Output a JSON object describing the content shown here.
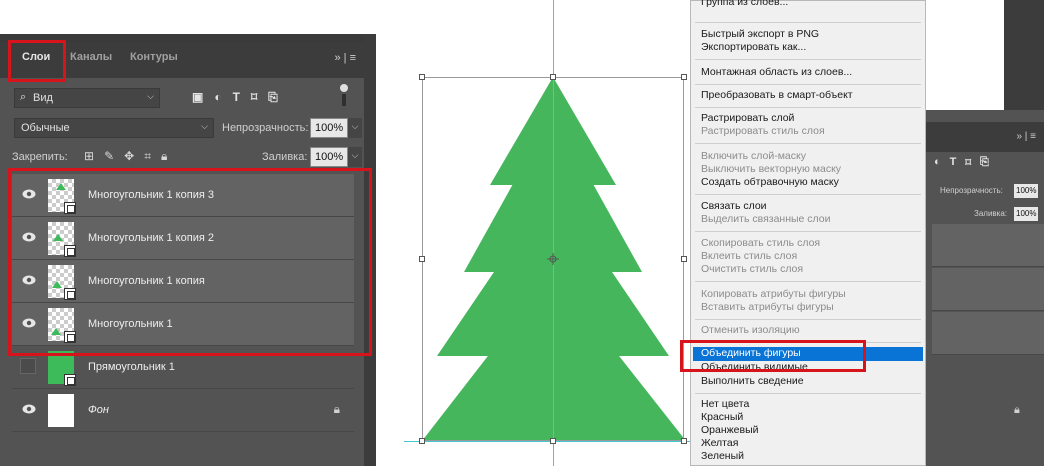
{
  "layers_panel": {
    "tabs": [
      "Слои",
      "Каналы",
      "Контуры"
    ],
    "menu_glyph": "»  |  ≡",
    "filter": {
      "search_glyph": "⌕",
      "label": "Вид"
    },
    "blend_mode": "Обычные",
    "opacity_label": "Непрозрачность:",
    "opacity_value": "100%",
    "lock_label": "Закрепить:",
    "fill_label": "Заливка:",
    "fill_value": "100%",
    "layers": [
      {
        "name": "Многоугольник 1 копия 3",
        "visible": true,
        "kind": "polygon"
      },
      {
        "name": "Многоугольник 1 копия 2",
        "visible": true,
        "kind": "polygon"
      },
      {
        "name": "Многоугольник 1 копия",
        "visible": true,
        "kind": "polygon"
      },
      {
        "name": "Многоугольник 1",
        "visible": true,
        "kind": "polygon"
      },
      {
        "name": "Прямоугольник 1",
        "visible": false,
        "kind": "rectangle"
      },
      {
        "name": "Фон",
        "visible": true,
        "kind": "background",
        "locked": true
      }
    ],
    "icons": {
      "filter_icons": [
        "image-filter-icon",
        "adjustment-filter-icon",
        "type-filter-icon",
        "shape-filter-icon",
        "smart-object-filter-icon"
      ],
      "lock_icons": [
        "lock-transparent-icon",
        "lock-image-icon",
        "lock-position-icon",
        "lock-artboard-icon",
        "lock-all-icon"
      ]
    }
  },
  "context_menu": {
    "items": [
      {
        "label": "Группа из слоев...",
        "disabled": false
      },
      {
        "label": "Быстрый экспорт в PNG",
        "disabled": false
      },
      {
        "label": "Экспортировать как...",
        "disabled": false
      },
      {
        "label": "Монтажная область из слоев...",
        "disabled": false
      },
      {
        "label": "Преобразовать в смарт-объект",
        "disabled": false
      },
      {
        "label": "Растрировать слой",
        "disabled": false
      },
      {
        "label": "Растрировать стиль слоя",
        "disabled": true
      },
      {
        "label": "Включить слой-маску",
        "disabled": true
      },
      {
        "label": "Выключить векторную маску",
        "disabled": true
      },
      {
        "label": "Создать обтравочную маску",
        "disabled": false
      },
      {
        "label": "Связать слои",
        "disabled": false
      },
      {
        "label": "Выделить связанные слои",
        "disabled": true
      },
      {
        "label": "Скопировать стиль слоя",
        "disabled": true
      },
      {
        "label": "Вклеить стиль слоя",
        "disabled": true
      },
      {
        "label": "Очистить стиль слоя",
        "disabled": true
      },
      {
        "label": "Копировать атрибуты фигуры",
        "disabled": true
      },
      {
        "label": "Вставить атрибуты фигуры",
        "disabled": true
      },
      {
        "label": "Отменить изоляцию",
        "disabled": true
      },
      {
        "label": "Объединить фигуры",
        "disabled": false,
        "highlighted": true
      },
      {
        "label": "Объединить видимые",
        "disabled": false
      },
      {
        "label": "Выполнить сведение",
        "disabled": false
      },
      {
        "label": "Нет цвета",
        "disabled": false
      },
      {
        "label": "Красный",
        "disabled": false
      },
      {
        "label": "Оранжевый",
        "disabled": false
      },
      {
        "label": "Желтая",
        "disabled": false
      },
      {
        "label": "Зеленый",
        "disabled": false
      }
    ]
  },
  "background_panel": {
    "menu_glyph": "»  |  ≡",
    "opacity_label": "Непрозрачность:",
    "opacity_value": "100%",
    "fill_label": "Заливка:",
    "fill_value": "100%"
  },
  "colors": {
    "tree_green": "#45b65c",
    "guide": "#46c8ce",
    "highlight": "#d7141b",
    "menu_selection": "#0a74d6",
    "panel_bg": "#535353"
  }
}
